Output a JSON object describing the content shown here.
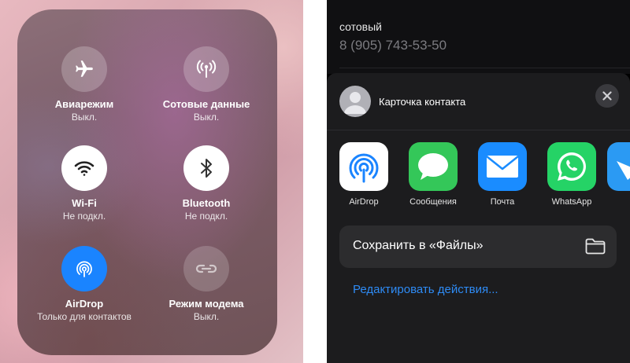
{
  "control_center": {
    "tiles": [
      {
        "id": "airplane",
        "icon": "airplane-icon",
        "label": "Авиарежим",
        "status": "Выкл."
      },
      {
        "id": "cellular",
        "icon": "antenna-icon",
        "label": "Сотовые данные",
        "status": "Выкл."
      },
      {
        "id": "wifi",
        "icon": "wifi-icon",
        "label": "Wi-Fi",
        "status": "Не подкл."
      },
      {
        "id": "bluetooth",
        "icon": "bluetooth-icon",
        "label": "Bluetooth",
        "status": "Не подкл."
      },
      {
        "id": "airdrop",
        "icon": "airdrop-icon",
        "label": "AirDrop",
        "status": "Только для контактов"
      },
      {
        "id": "hotspot",
        "icon": "link-icon",
        "label": "Режим модема",
        "status": "Выкл."
      }
    ]
  },
  "contact": {
    "field_label": "сотовый",
    "phone": "8 (905) 743-53-50"
  },
  "share_sheet": {
    "title": "Карточка контакта",
    "apps": [
      {
        "icon": "airdrop-icon",
        "label": "AirDrop"
      },
      {
        "icon": "messages-icon",
        "label": "Сообщения"
      },
      {
        "icon": "mail-icon",
        "label": "Почта"
      },
      {
        "icon": "whatsapp-icon",
        "label": "WhatsApp"
      }
    ],
    "save_to_files": "Сохранить в «Файлы»",
    "edit_actions": "Редактировать действия..."
  },
  "colors": {
    "accent_blue": "#1a84ff",
    "link_blue": "#2e8bf5",
    "messages_green": "#34c759",
    "whatsapp_green": "#25d366"
  }
}
